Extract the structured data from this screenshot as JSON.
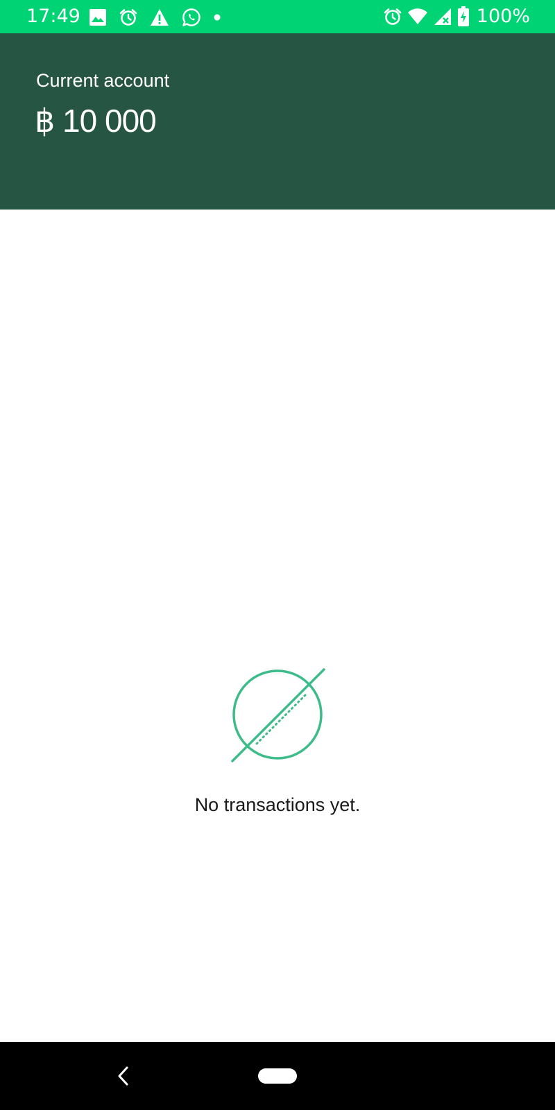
{
  "status_bar": {
    "time": "17:49",
    "battery_text": "100%",
    "background_color": "#00d374",
    "left_icons": [
      "image-icon",
      "alarm-icon",
      "warning-icon",
      "whatsapp-icon",
      "dot-icon"
    ],
    "right_icons": [
      "alarm-icon",
      "wifi-icon",
      "signal-icon",
      "battery-icon"
    ]
  },
  "header": {
    "account_name": "Current account",
    "balance": "฿ 10 000",
    "background_color": "#265543"
  },
  "empty_state": {
    "icon": "no-transactions-icon",
    "message": "No transactions yet.",
    "accent_color": "#3dbb8a"
  },
  "nav_bar": {
    "back_icon": "back-icon",
    "home_icon": "home-pill-icon"
  }
}
